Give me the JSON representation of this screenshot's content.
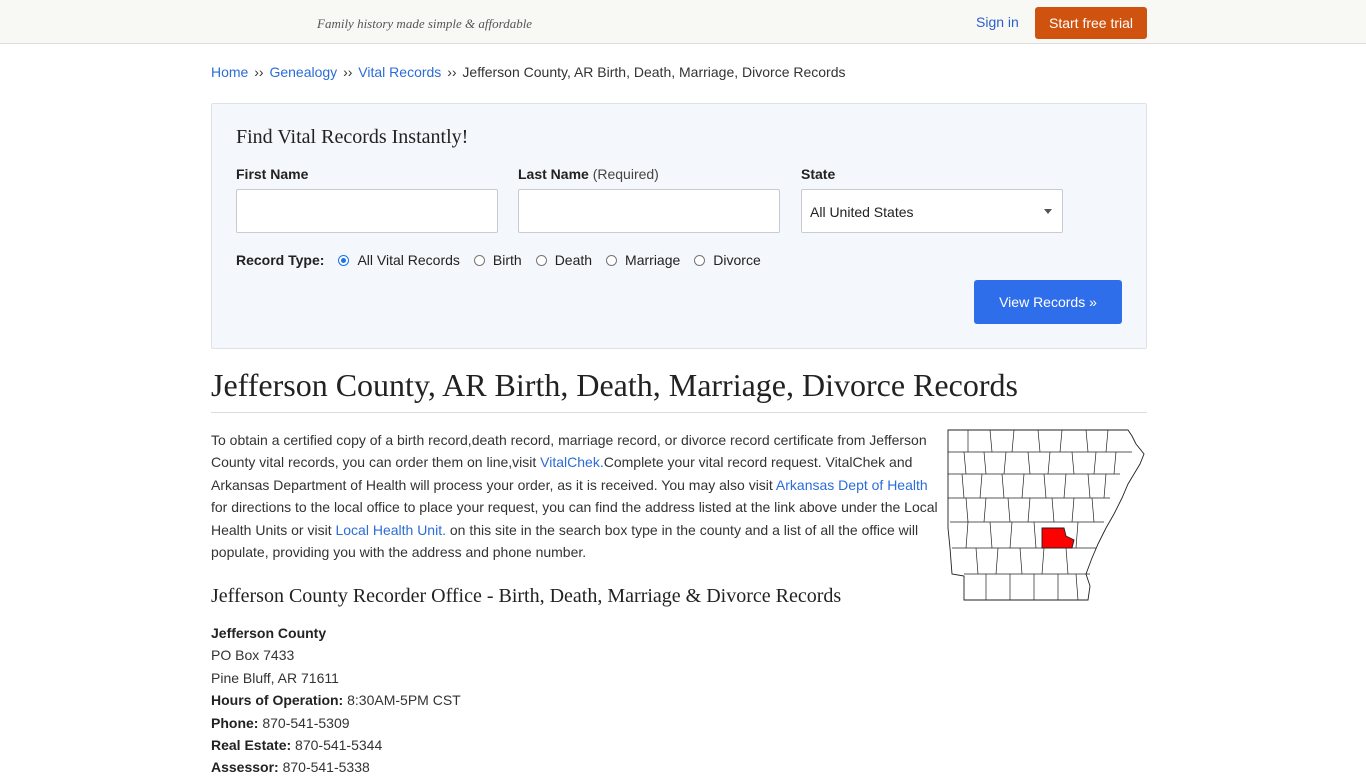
{
  "header": {
    "tagline": "Family history made simple & affordable",
    "signin": "Sign in",
    "trial": "Start free trial"
  },
  "breadcrumb": {
    "home": "Home",
    "genealogy": "Genealogy",
    "vital": "Vital Records",
    "current": "Jefferson County, AR Birth, Death, Marriage, Divorce Records",
    "separator": "››"
  },
  "search": {
    "title": "Find Vital Records Instantly!",
    "first_label": "First Name",
    "last_label": "Last Name",
    "last_required": "(Required)",
    "state_label": "State",
    "state_value": "All United States",
    "record_type_label": "Record Type:",
    "record_types": [
      "All Vital Records",
      "Birth",
      "Death",
      "Marriage",
      "Divorce"
    ],
    "selected": "All Vital Records",
    "button": "View Records »"
  },
  "page": {
    "title": "Jefferson County, AR Birth, Death, Marriage, Divorce Records",
    "intro_1": "To obtain a certified copy of a birth record,death record, marriage record, or divorce record certificate from Jefferson County vital records, you can order them on line,visit ",
    "link_vitalchek": "VitalChek.",
    "intro_2": "Complete your vital record request. VitalChek and Arkansas Department of Health will process your order, as it is received. You may also visit ",
    "link_adh": "Arkansas Dept of Health",
    "intro_3": " for directions to the local office to place your request, you can find the address listed at the link above under the Local Health Units or visit ",
    "link_local": "Local Health Unit.",
    "intro_4": " on this site in the search box type in the county and a list of all the office will populate, providing you with the address and phone number.",
    "section_title": "Jefferson County Recorder Office - Birth, Death, Marriage & Divorce Records"
  },
  "office": {
    "name": "Jefferson County",
    "address1": "PO Box 7433",
    "address2": "Pine Bluff, AR 71611",
    "hours_label": "Hours of Operation:",
    "hours": "8:30AM-5PM CST",
    "phone_label": "Phone:",
    "phone": "870-541-5309",
    "realestate_label": "Real Estate:",
    "realestate": "870-541-5344",
    "assessor_label": "Assessor:",
    "assessor": "870-541-5338"
  },
  "colors": {
    "accent_orange": "#d0520f",
    "button_blue": "#2f6eea",
    "link_blue": "#2b6cd8",
    "map_highlight": "#ff0000"
  }
}
